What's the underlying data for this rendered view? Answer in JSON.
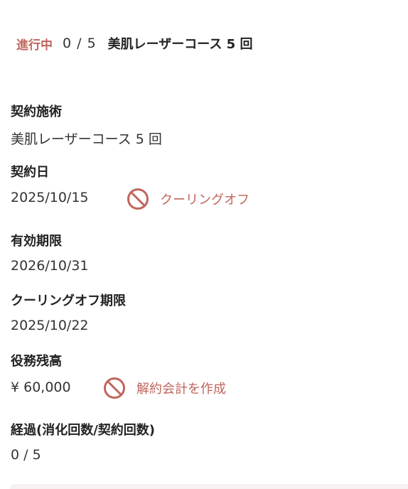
{
  "header": {
    "status": "進行中",
    "progress": "0 / 5",
    "course_title": "美肌レーザーコース 5 回"
  },
  "fields": {
    "contract_treatment": {
      "label": "契約施術",
      "value": "美肌レーザーコース 5 回"
    },
    "contract_date": {
      "label": "契約日",
      "value": "2025/10/15"
    },
    "expiry_date": {
      "label": "有効期限",
      "value": "2026/10/31"
    },
    "cooling_off_deadline": {
      "label": "クーリングオフ期限",
      "value": "2025/10/22"
    },
    "service_balance": {
      "label": "役務残高",
      "value": "¥ 60,000"
    },
    "usage_progress": {
      "label": "経過(消化回数/契約回数)",
      "value": "0 / 5"
    }
  },
  "actions": {
    "cooling_off": {
      "label": "クーリングオフ",
      "icon": "prohibited-icon"
    },
    "create_cancellation_invoice": {
      "label": "解約会計を作成",
      "icon": "prohibited-icon"
    }
  },
  "colors": {
    "accent": "#c0655c",
    "text": "#222222",
    "strip": "#f7f1f1"
  }
}
